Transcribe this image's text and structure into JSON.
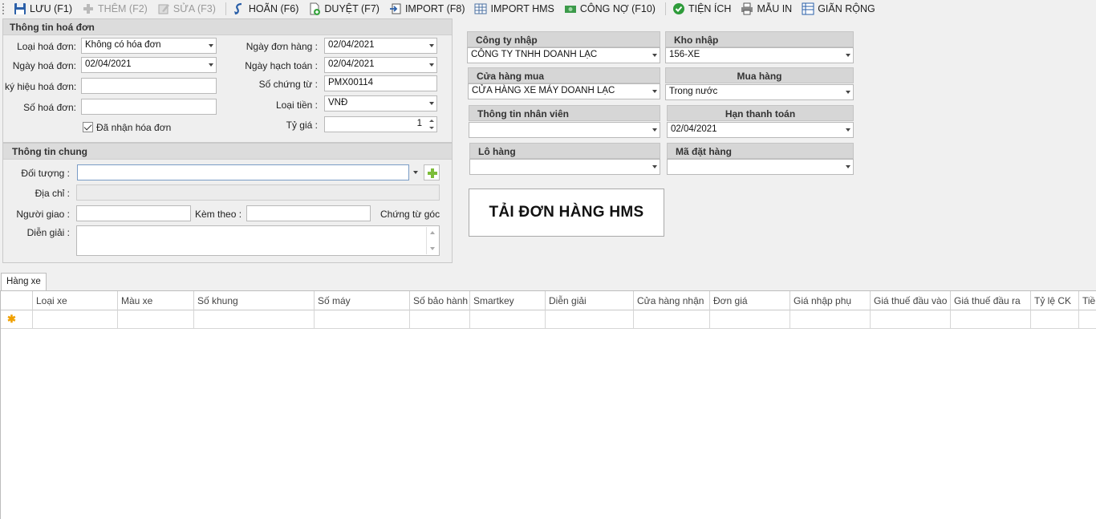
{
  "toolbar": {
    "save": "LƯU (F1)",
    "add": "THÊM (F2)",
    "edit": "SỬA (F3)",
    "undo": "HOÃN (F6)",
    "approve": "DUYỆT (F7)",
    "import": "IMPORT (F8)",
    "import_hms": "IMPORT HMS",
    "debt": "CÔNG NỢ (F10)",
    "utilities": "TIỆN ÍCH",
    "print_template": "MẪU IN",
    "expand": "GIÃN RỘNG"
  },
  "invoice": {
    "title": "Thông tin hoá đơn",
    "type_label": "Loại hoá đơn:",
    "type_value": "Không có hóa đơn",
    "date_label": "Ngày hoá đơn:",
    "date_value": "02/04/2021",
    "symbol_label": "ký hiệu hoá đơn:",
    "symbol_value": "",
    "number_label": "Số hoá đơn:",
    "number_value": "",
    "received_label": "Đã nhận hóa đơn",
    "order_date_label": "Ngày đơn hàng :",
    "order_date_value": "02/04/2021",
    "account_date_label": "Ngày hạch toán :",
    "account_date_value": "02/04/2021",
    "voucher_label": "Số chứng từ :",
    "voucher_value": "PMX00114",
    "currency_label": "Loại tiền :",
    "currency_value": "VNĐ",
    "rate_label": "Tỷ giá :",
    "rate_value": "1"
  },
  "general": {
    "title": "Thông tin chung",
    "object_label": "Đối tượng :",
    "object_value": "",
    "address_label": "Địa chỉ :",
    "address_value": "",
    "deliverer_label": "Người giao :",
    "deliverer_value": "",
    "attach_label": "Kèm theo :",
    "attach_value": "",
    "original_docs": "Chứng từ góc",
    "description_label": "Diễn giải :",
    "description_value": ""
  },
  "right": {
    "company_label": "Công ty nhập",
    "company_value": "CÔNG TY TNHH DOANH LẠC",
    "warehouse_label": "Kho nhập",
    "warehouse_value": "156-XE",
    "store_label": "Cửa hàng mua",
    "store_value": "CỬA HÀNG XE MÁY DOANH LẠC",
    "purchase_label": "Mua hàng",
    "purchase_value": "Trong nước",
    "staff_label": "Thông tin nhân viên",
    "staff_value": "",
    "due_label": "Hạn thanh toán",
    "due_value": "02/04/2021",
    "lot_label": "Lô hàng",
    "lot_value": "",
    "order_code_label": "Mã đặt hàng",
    "order_code_value": "",
    "load_button": "TẢI ĐƠN HÀNG HMS"
  },
  "grid": {
    "tab": "Hàng xe",
    "columns": [
      "Loại xe",
      "Màu xe",
      "Số khung",
      "Số máy",
      "Số bảo hành",
      "Smartkey",
      "Diễn giải",
      "Cửa hàng nhận",
      "Đơn giá",
      "Giá nhập phụ",
      "Giá thuế đầu vào",
      "Giá thuế đầu ra",
      "Tỷ lệ CK",
      "Tiền"
    ]
  },
  "colors": {
    "accent": "#2a6fb5",
    "green": "#2e9b3a"
  }
}
